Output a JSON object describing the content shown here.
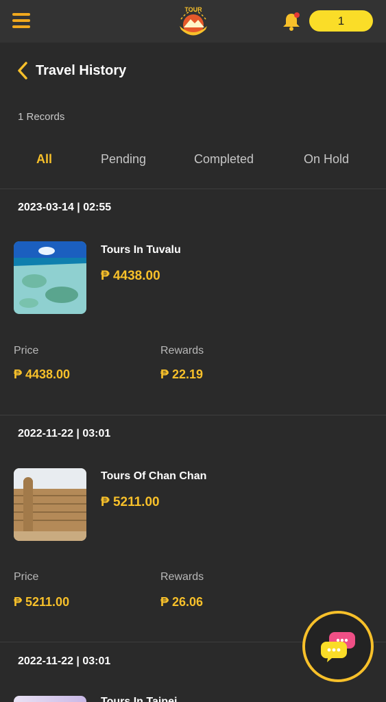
{
  "topbar": {
    "balance": "1",
    "logo_text": "TOUR"
  },
  "page": {
    "title": "Travel History",
    "record_count": "1 Records"
  },
  "tabs": [
    "All",
    "Pending",
    "Completed",
    "On Hold"
  ],
  "active_tab": "All",
  "labels": {
    "price": "Price",
    "rewards": "Rewards"
  },
  "records": [
    {
      "datetime": "2023-03-14 | 02:55",
      "name": "Tours In Tuvalu",
      "amount": "₱ 4438.00",
      "price": "₱ 4438.00",
      "rewards": "₱ 22.19",
      "thumb": "ocean-reef"
    },
    {
      "datetime": "2022-11-22 | 03:01",
      "name": "Tours Of Chan Chan",
      "amount": "₱ 5211.00",
      "price": "₱ 5211.00",
      "rewards": "₱ 26.06",
      "thumb": "adobe-ruins"
    },
    {
      "datetime": "2022-11-22 | 03:01",
      "name": "Tours In Taipei",
      "thumb": "city"
    }
  ],
  "colors": {
    "accent": "#f7c02a",
    "background": "#2a2a2a",
    "topbar": "#333333",
    "balance_pill": "#fadd28"
  },
  "icons": {
    "menu": "hamburger-icon",
    "bell": "bell-icon",
    "back": "chevron-left-icon",
    "chat": "chat-bubbles-icon"
  }
}
